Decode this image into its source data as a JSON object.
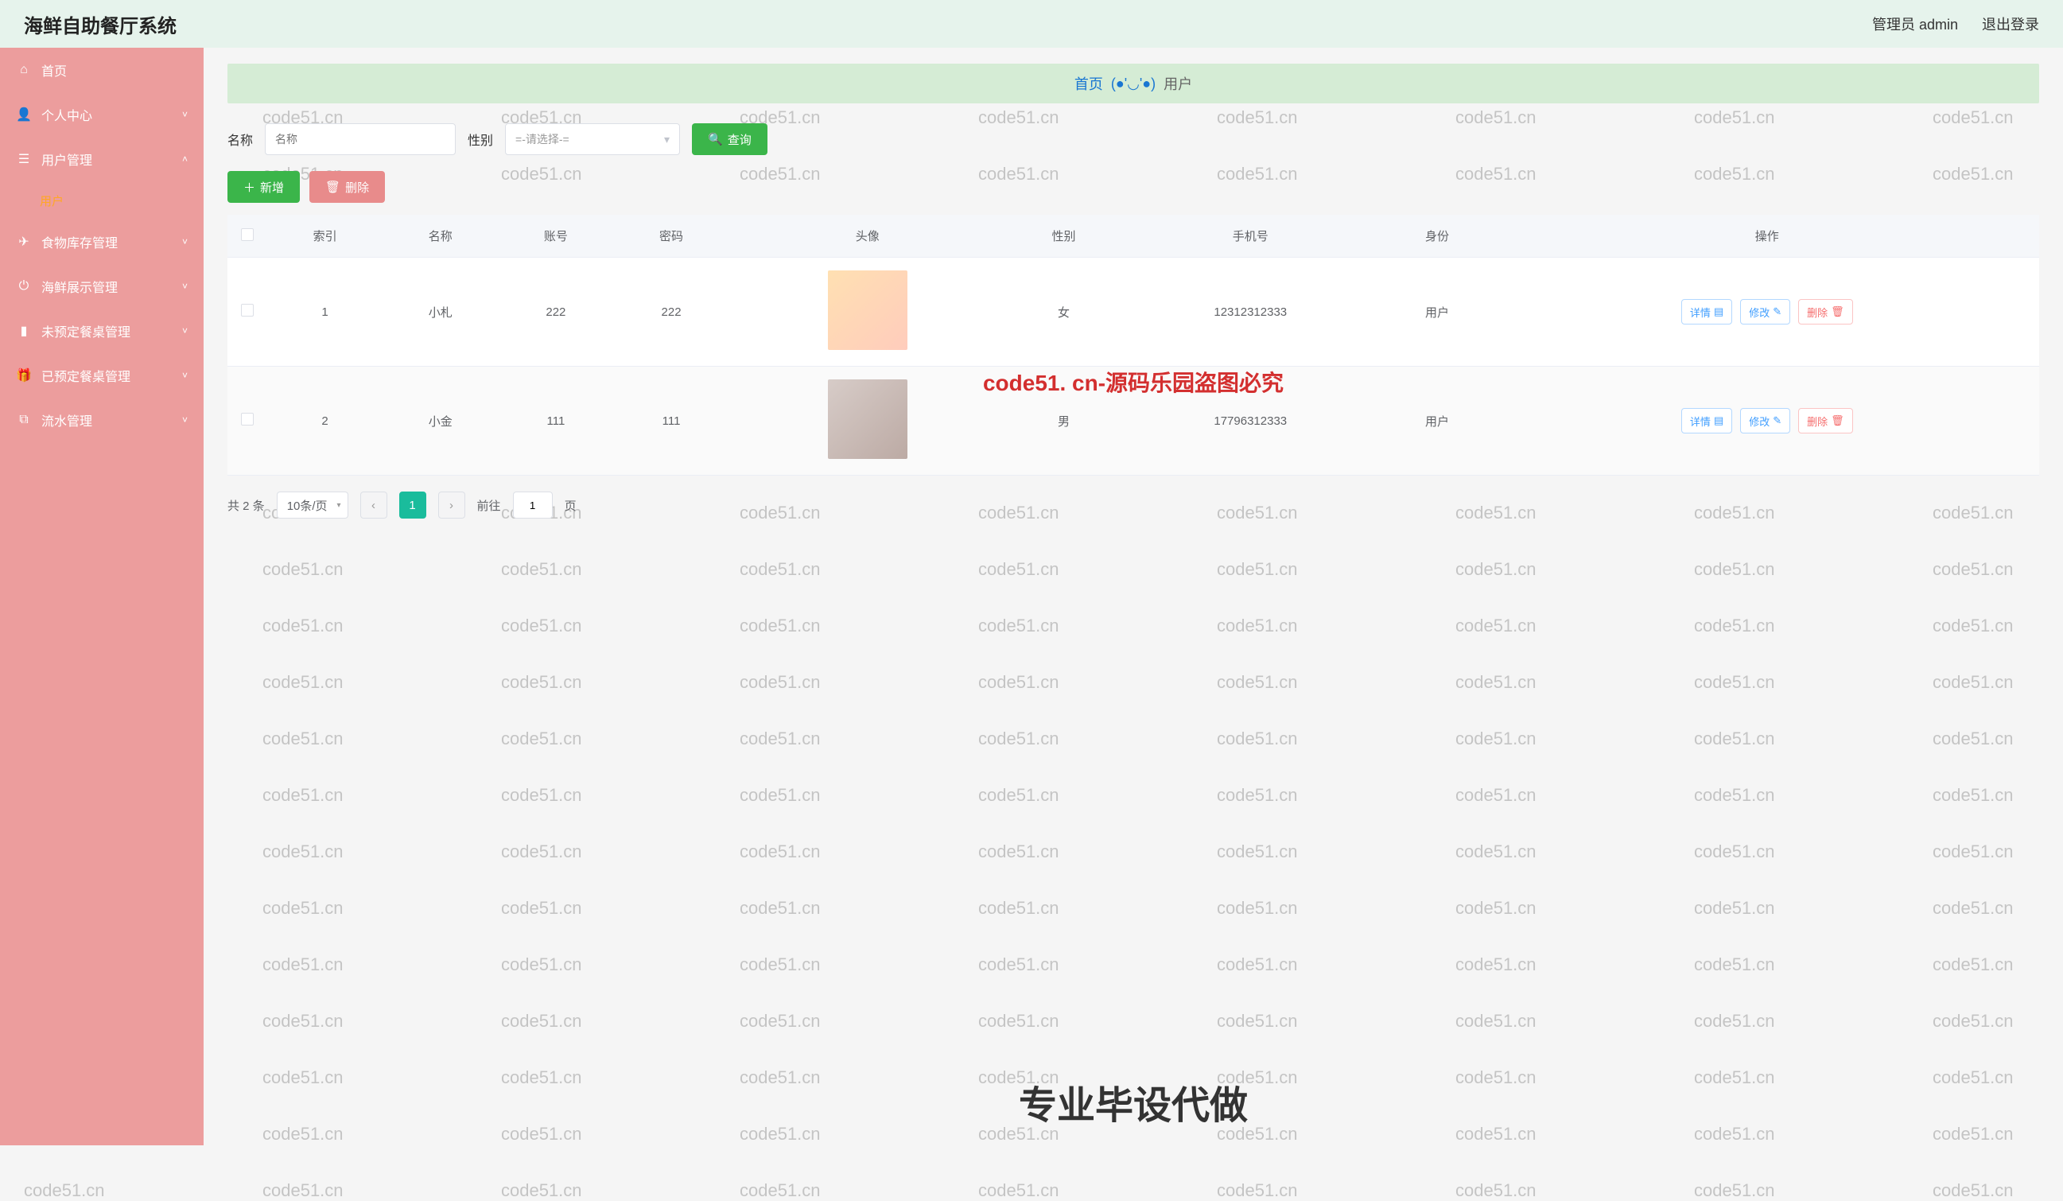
{
  "header": {
    "title": "海鲜自助餐厅系统",
    "user_label": "管理员 admin",
    "logout": "退出登录"
  },
  "sidebar": {
    "items": [
      {
        "icon": "home",
        "label": "首页",
        "expand": null
      },
      {
        "icon": "user",
        "label": "个人中心",
        "expand": "down"
      },
      {
        "icon": "users",
        "label": "用户管理",
        "expand": "up",
        "sub": [
          {
            "label": "用户",
            "active": true
          }
        ]
      },
      {
        "icon": "send",
        "label": "食物库存管理",
        "expand": "down"
      },
      {
        "icon": "power",
        "label": "海鲜展示管理",
        "expand": "down"
      },
      {
        "icon": "bookmark",
        "label": "未预定餐桌管理",
        "expand": "down"
      },
      {
        "icon": "gift",
        "label": "已预定餐桌管理",
        "expand": "down"
      },
      {
        "icon": "copy",
        "label": "流水管理",
        "expand": "down"
      }
    ]
  },
  "breadcrumb": {
    "home": "首页",
    "face": "(●'◡'●)",
    "current": "用户"
  },
  "filter": {
    "name_label": "名称",
    "name_placeholder": "名称",
    "gender_label": "性别",
    "gender_placeholder": "=-请选择-=",
    "search_btn": "查询"
  },
  "actions": {
    "add": "新增",
    "delete": "删除"
  },
  "table": {
    "headers": [
      "索引",
      "名称",
      "账号",
      "密码",
      "头像",
      "性别",
      "手机号",
      "身份",
      "操作"
    ],
    "rows": [
      {
        "idx": "1",
        "name": "小札",
        "account": "222",
        "password": "222",
        "gender": "女",
        "phone": "12312312333",
        "role": "用户"
      },
      {
        "idx": "2",
        "name": "小金",
        "account": "111",
        "password": "111",
        "gender": "男",
        "phone": "17796312333",
        "role": "用户"
      }
    ],
    "ops": {
      "detail": "详情",
      "edit": "修改",
      "delete": "删除"
    }
  },
  "pagination": {
    "total": "共 2 条",
    "page_size": "10条/页",
    "current": "1",
    "jump_prefix": "前往",
    "jump_value": "1",
    "jump_suffix": "页"
  },
  "overlay": {
    "line1": "code51. cn-源码乐园盗图必究",
    "line2": "专业毕设代做"
  },
  "watermark": "code51.cn"
}
